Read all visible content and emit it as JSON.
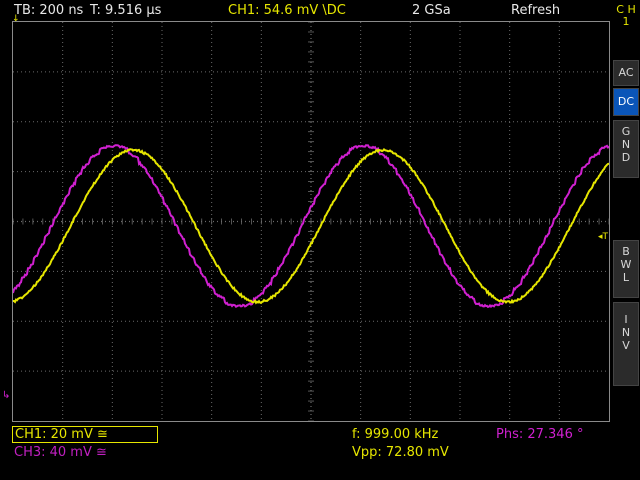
{
  "topbar": {
    "timebase": "TB: 200 ns",
    "trigger_time": "T: 9.516 µs",
    "ch1_trigger": "CH1: 54.6 mV \\DC",
    "sample_rate": "2 GSa",
    "mode": "Refresh"
  },
  "sidebar": {
    "channel_label": [
      "C",
      "H",
      "1"
    ],
    "buttons": [
      {
        "label": [
          "AC"
        ],
        "active": false
      },
      {
        "label": [
          "DC"
        ],
        "active": true
      },
      {
        "label": [
          "G",
          "N",
          "D"
        ],
        "active": false
      },
      {
        "label": [
          "B",
          "W",
          "L"
        ],
        "active": false
      },
      {
        "label": [
          "I",
          "N",
          "V"
        ],
        "active": false
      }
    ]
  },
  "markers": {
    "trigger_top": "↓",
    "trigger_right": "◂T",
    "ch3": "↳"
  },
  "bottom": {
    "ch1_scale": "CH1: 20 mV ≅",
    "ch3_scale": "CH3: 40 mV ≅",
    "frequency": "f: 999.00 kHz",
    "vpp": "Vpp: 72.80 mV",
    "phase": "Phs: 27.346 °"
  },
  "colors": {
    "ch1": "#e6e600",
    "ch3": "#d020d0",
    "grid": "#6a6a6a",
    "background": "#000000",
    "active_button": "#0a55b8"
  },
  "waveforms": {
    "ch1": {
      "frequency_khz": 999.0,
      "vpp_mv": 72.8,
      "shape": "sine"
    },
    "ch3": {
      "frequency_khz": 999.0,
      "shape": "stepped-sine",
      "phase_deg": 27.346
    }
  }
}
